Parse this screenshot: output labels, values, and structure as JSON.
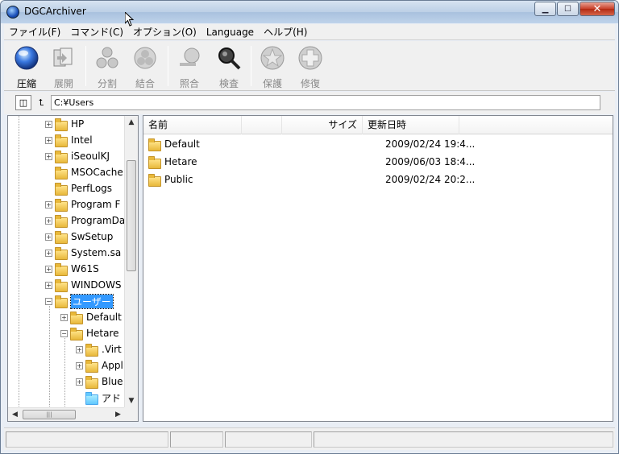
{
  "window": {
    "title": "DGCArchiver"
  },
  "menu": [
    "ファイル(F)",
    "コマンド(C)",
    "オプション(O)",
    "Language",
    "ヘルプ(H)"
  ],
  "toolbar": [
    {
      "label": "圧縮",
      "icon": "compress-icon",
      "enabled": true
    },
    {
      "label": "展開",
      "icon": "extract-icon",
      "enabled": false
    },
    {
      "label": "分割",
      "icon": "split-icon",
      "enabled": false
    },
    {
      "label": "結合",
      "icon": "join-icon",
      "enabled": false
    },
    {
      "label": "照合",
      "icon": "verify-icon",
      "enabled": false
    },
    {
      "label": "検査",
      "icon": "inspect-icon",
      "enabled": false
    },
    {
      "label": "保護",
      "icon": "protect-icon",
      "enabled": false
    },
    {
      "label": "修復",
      "icon": "repair-icon",
      "enabled": false
    }
  ],
  "address": {
    "path": "C:¥Users"
  },
  "tree": [
    {
      "label": "HP",
      "level": 0,
      "expander": "+"
    },
    {
      "label": "Intel",
      "level": 0,
      "expander": "+"
    },
    {
      "label": "iSeoulKJ",
      "level": 0,
      "expander": "+"
    },
    {
      "label": "MSOCache",
      "level": 0,
      "expander": ""
    },
    {
      "label": "PerfLogs",
      "level": 0,
      "expander": ""
    },
    {
      "label": "Program F",
      "level": 0,
      "expander": "+"
    },
    {
      "label": "ProgramDa",
      "level": 0,
      "expander": "+"
    },
    {
      "label": "SwSetup",
      "level": 0,
      "expander": "+"
    },
    {
      "label": "System.sa",
      "level": 0,
      "expander": "+"
    },
    {
      "label": "W61S",
      "level": 0,
      "expander": "+"
    },
    {
      "label": "WINDOWS",
      "level": 0,
      "expander": "+"
    },
    {
      "label": "ユーザー",
      "level": 0,
      "expander": "−",
      "selected": true
    },
    {
      "label": "Default",
      "level": 1,
      "expander": "+"
    },
    {
      "label": "Hetare",
      "level": 1,
      "expander": "−"
    },
    {
      "label": ".Virt",
      "level": 2,
      "expander": "+"
    },
    {
      "label": "Appl",
      "level": 2,
      "expander": "+"
    },
    {
      "label": "Blue",
      "level": 2,
      "expander": "+"
    },
    {
      "label": "アド",
      "level": 2,
      "expander": "",
      "special": true
    }
  ],
  "list": {
    "columns": [
      "名前",
      "サイズ",
      "更新日時"
    ],
    "rows": [
      {
        "name": "Default",
        "size": "",
        "modified": "2009/02/24 19:4..."
      },
      {
        "name": "Hetare",
        "size": "",
        "modified": "2009/06/03 18:4..."
      },
      {
        "name": "Public",
        "size": "",
        "modified": "2009/02/24 20:2..."
      }
    ]
  }
}
